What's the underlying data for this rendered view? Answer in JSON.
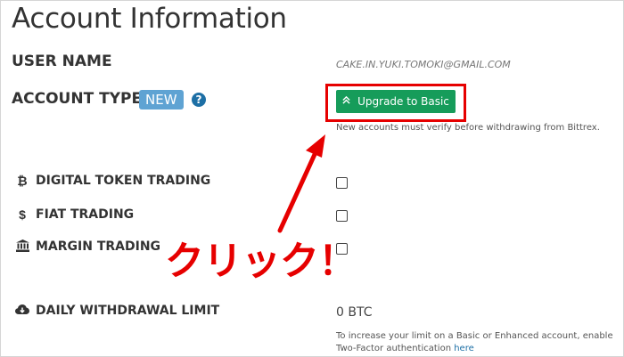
{
  "page": {
    "title": "Account Information"
  },
  "account": {
    "user_name_label": "USER NAME",
    "user_email": "CAKE.IN.YUKI.TOMOKI@GMAIL.COM",
    "account_type_label": "ACCOUNT TYPE",
    "account_type_badge": "NEW",
    "help_glyph": "?",
    "upgrade_button_label": "Upgrade to Basic",
    "upgrade_chevron": "»",
    "verify_note": "New accounts must verify before withdrawing from Bittrex."
  },
  "trading": {
    "digital_label": "DIGITAL TOKEN TRADING",
    "digital_icon": "₿",
    "fiat_label": "FIAT TRADING",
    "fiat_icon": "$",
    "margin_label": "MARGIN TRADING",
    "margin_icon": "🏛"
  },
  "withdrawal": {
    "label": "DAILY WITHDRAWAL LIMIT",
    "value": "0 BTC",
    "note_text": "To increase your limit on a Basic or Enhanced account, enable Two-Factor authentication ",
    "note_link": "here"
  },
  "annotation": {
    "click_text": "クリック！",
    "color": "#e60000"
  },
  "colors": {
    "button_green": "#169c5a",
    "badge_blue": "#5fa3d3",
    "link_blue": "#1d6fa5"
  }
}
